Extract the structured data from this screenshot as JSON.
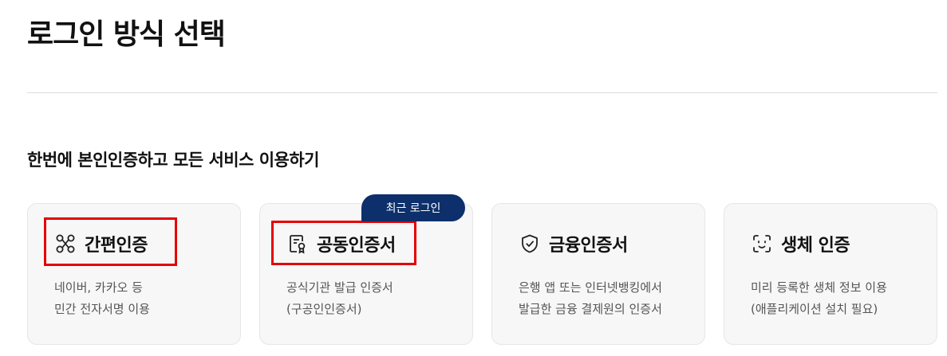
{
  "page": {
    "title": "로그인 방식 선택",
    "section_title": "한번에 본인인증하고 모든 서비스 이용하기"
  },
  "recent_badge": "최근 로그인",
  "cards": [
    {
      "icon": "share-nodes-icon",
      "title": "간편인증",
      "desc_line1": "네이버, 카카오 등",
      "desc_line2": "민간 전자서명 이용"
    },
    {
      "icon": "certificate-document-icon",
      "title": "공동인증서",
      "desc_line1": "공식기관 발급 인증서",
      "desc_line2": "(구공인인증서)"
    },
    {
      "icon": "shield-check-icon",
      "title": "금융인증서",
      "desc_line1": "은행 앱 또는 인터넷뱅킹에서",
      "desc_line2": "발급한 금융 결제원의 인증서"
    },
    {
      "icon": "face-scan-icon",
      "title": "생체 인증",
      "desc_line1": "미리 등록한 생체 정보 이용",
      "desc_line2": "(애플리케이션 설치 필요)"
    }
  ],
  "colors": {
    "highlight": "#e60000",
    "badge_bg": "#0d2f6b",
    "card_bg": "#f7f7f8"
  }
}
